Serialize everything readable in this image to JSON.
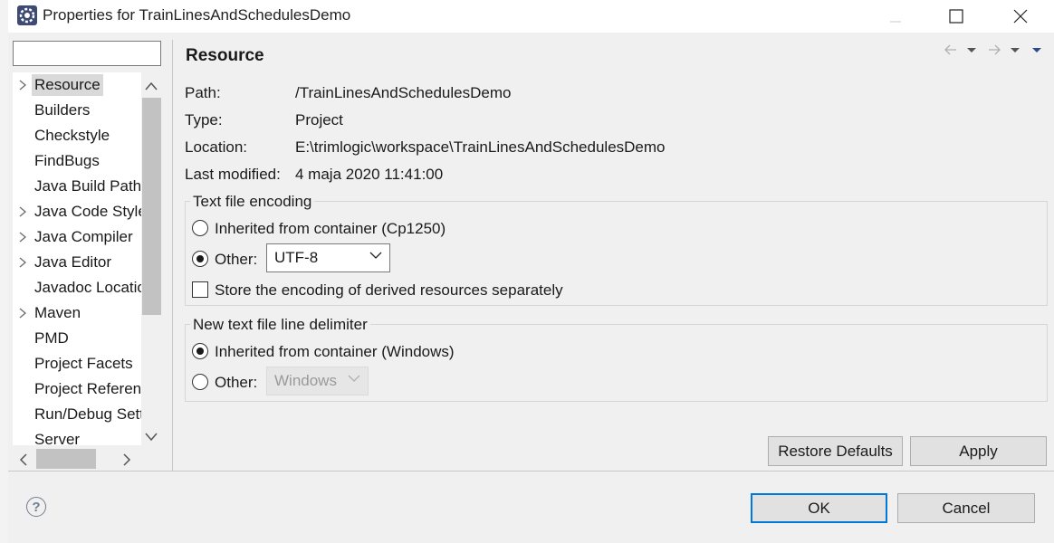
{
  "window": {
    "title": "Properties for TrainLinesAndSchedulesDemo"
  },
  "filter": {
    "value": ""
  },
  "tree": {
    "items": [
      {
        "label": "Resource",
        "expandable": true,
        "selected": true
      },
      {
        "label": "Builders",
        "expandable": false
      },
      {
        "label": "Checkstyle",
        "expandable": false
      },
      {
        "label": "FindBugs",
        "expandable": false
      },
      {
        "label": "Java Build Path",
        "expandable": false
      },
      {
        "label": "Java Code Style",
        "expandable": true
      },
      {
        "label": "Java Compiler",
        "expandable": true
      },
      {
        "label": "Java Editor",
        "expandable": true
      },
      {
        "label": "Javadoc Location",
        "expandable": false
      },
      {
        "label": "Maven",
        "expandable": true
      },
      {
        "label": "PMD",
        "expandable": false
      },
      {
        "label": "Project Facets",
        "expandable": false
      },
      {
        "label": "Project References",
        "expandable": false
      },
      {
        "label": "Run/Debug Settings",
        "expandable": false
      },
      {
        "label": "Server",
        "expandable": false
      }
    ]
  },
  "page": {
    "title": "Resource",
    "path_label": "Path:",
    "path_value": "/TrainLinesAndSchedulesDemo",
    "type_label": "Type:",
    "type_value": "Project",
    "location_label": "Location:",
    "location_value": "E:\\trimlogic\\workspace\\TrainLinesAndSchedulesDemo",
    "modified_label": "Last modified:",
    "modified_value": "4 maja 2020 11:41:00"
  },
  "encoding": {
    "group_title": "Text file encoding",
    "inherited_label": "Inherited from container (Cp1250)",
    "inherited_selected": false,
    "other_label": "Other:",
    "other_selected": true,
    "other_value": "UTF-8",
    "store_label": "Store the encoding of derived resources separately",
    "store_checked": false
  },
  "delimiter": {
    "group_title": "New text file line delimiter",
    "inherited_label": "Inherited from container (Windows)",
    "inherited_selected": true,
    "other_label": "Other:",
    "other_selected": false,
    "other_value": "Windows"
  },
  "buttons": {
    "restore_defaults": "Restore Defaults",
    "apply": "Apply",
    "ok": "OK",
    "cancel": "Cancel",
    "help": "?"
  }
}
